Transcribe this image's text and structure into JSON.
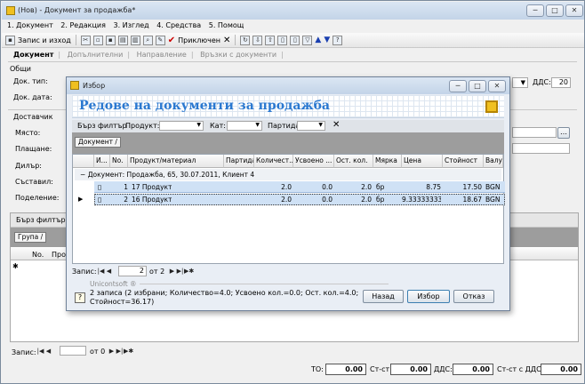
{
  "window": {
    "title": "(Нов) - Документ за продажба*",
    "minimize": "─",
    "maximize": "□",
    "close": "✕"
  },
  "menu": [
    "1. Документ",
    "2. Редакция",
    "3. Изглед",
    "4. Средства",
    "5. Помощ"
  ],
  "toolbar": {
    "save_exit": "Запис и изход",
    "apply": "Приключен"
  },
  "tabs": [
    "Документ",
    "Допълнителни",
    "Направление",
    "Връзки с документи"
  ],
  "general": {
    "section": "Общи",
    "doc_type_label": "Док. тип:",
    "doc_date_label": "Док. дата:",
    "vat_label": "ДДС:",
    "vat_value": "20"
  },
  "supplier": {
    "section": "Доставчик",
    "place_label": "Място:",
    "payment_label": "Плащане:",
    "dealer_label": "Дилър:",
    "composed_label": "Съставил:",
    "division_label": "Поделение:"
  },
  "lower": {
    "quick_filter": "Бърз филтър",
    "group": "Група",
    "col_no": "No.",
    "col_product": "Прод",
    "record_label": "Запис:",
    "record_of": "от 0"
  },
  "totals": {
    "to_label": "ТО:",
    "to_value": "0.00",
    "cost_label": "Ст-ст:",
    "cost_value": "0.00",
    "vat_label": "ДДС:",
    "vat_value": "0.00",
    "cost_vat_label": "Ст-ст с ДДС:",
    "cost_vat_value": "0.00"
  },
  "dialog": {
    "title": "Избор",
    "heading": "Редове на документи за продажба",
    "quick_filter": "Бърз филтър",
    "product_label": "Продукт:",
    "cat_label": "Кат:",
    "batch_label": "Партида:",
    "group_by": "Документ",
    "columns": [
      "И...",
      "No.",
      "Продукт/материал",
      "Партида",
      "Количест...",
      "Усвоено ...",
      "Ост. кол.",
      "Мярка",
      "Цена",
      "Стойност",
      "Валу"
    ],
    "group_row": "Документ: Продажба, 65, 30.07.2011, Клиент 4",
    "rows": [
      {
        "no": "1",
        "product": "17 Продукт",
        "qty": "2.0",
        "done": "0.0",
        "rest": "2.0",
        "unit": "бр",
        "price": "8.75",
        "value": "17.50",
        "cur": "BGN"
      },
      {
        "no": "2",
        "product": "16 Продукт",
        "qty": "2.0",
        "done": "0.0",
        "rest": "2.0",
        "unit": "бр",
        "price": "9.33333333",
        "value": "18.67",
        "cur": "BGN"
      }
    ],
    "record_label": "Запис:",
    "record_value": "2",
    "record_of": "от 2",
    "brand": "Unicontsoft ®",
    "status_line1": "2 записа (2 избрани; Количество=4.0; Усвоено кол.=0.0; Ост. кол.=4.0;",
    "status_line2": "Стойност=36.17)",
    "back_btn": "Назад",
    "select_btn": "Избор",
    "cancel_btn": "Отказ"
  }
}
